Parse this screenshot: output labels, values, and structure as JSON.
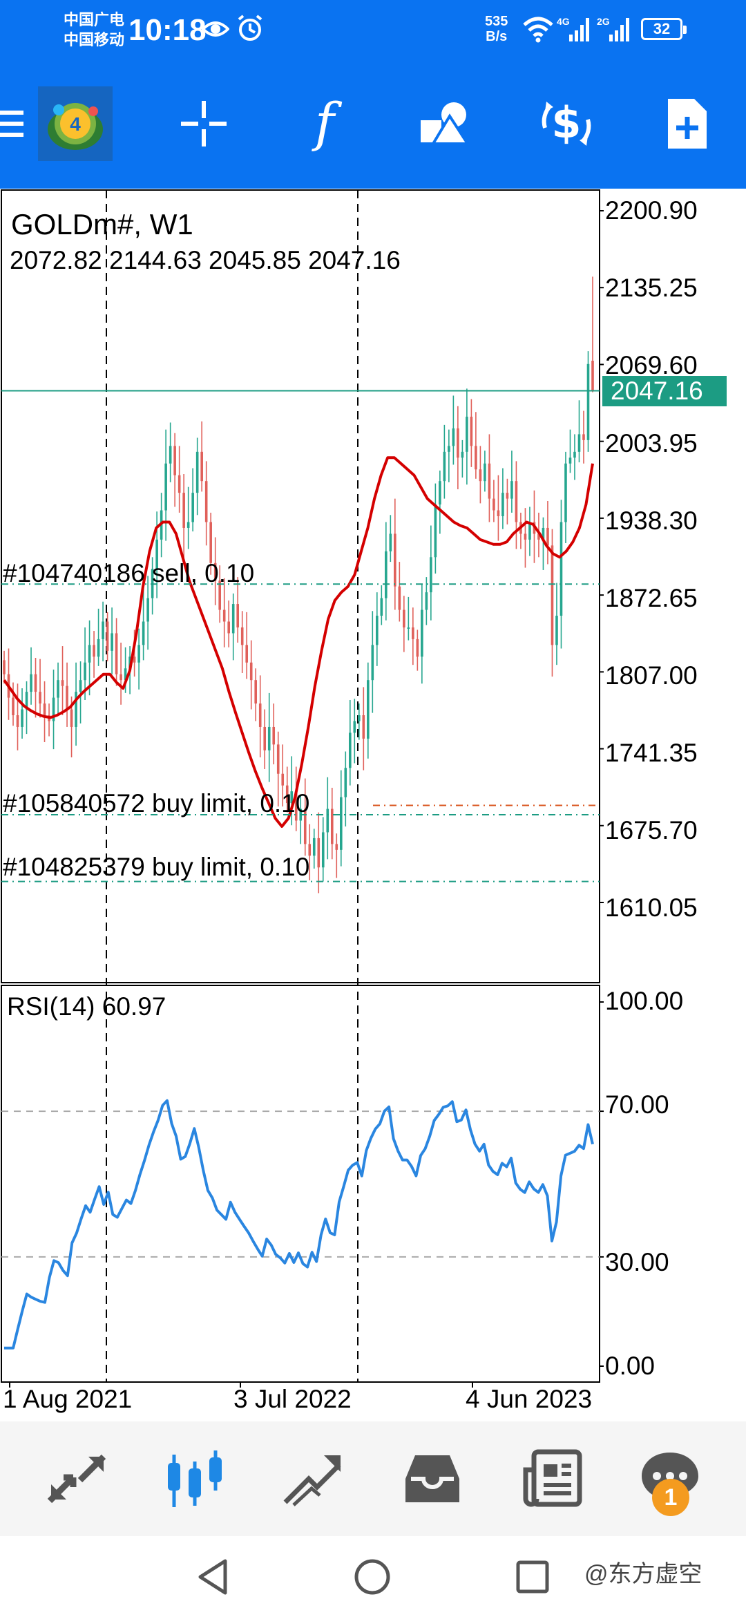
{
  "status_bar": {
    "carrier_line1": "中国广电",
    "carrier_line2": "中国移动",
    "time": "10:18",
    "net_speed_value": "535",
    "net_speed_unit": "B/s",
    "signal1_label": "4G",
    "signal2_label": "2G",
    "battery": "32",
    "icons": [
      "eye-icon",
      "alarm-off-icon",
      "wifi-icon",
      "signal-icon",
      "signal-icon",
      "battery-icon"
    ]
  },
  "toolbar": {
    "items": [
      "menu-icon",
      "app-logo",
      "crosshair-icon",
      "function-icon",
      "objects-icon",
      "trade-icon",
      "new-order-icon"
    ]
  },
  "chart": {
    "symbol_title": "GOLDm#, W1",
    "ohlc": "2072.82 2144.63 2045.85 2047.16",
    "current_price": "2047.16",
    "price_labels": [
      "2200.90",
      "2135.25",
      "2069.60",
      "2003.95",
      "1938.30",
      "1872.65",
      "1807.00",
      "1741.35",
      "1675.70",
      "1610.05"
    ],
    "orders": [
      {
        "label": "#104740186 sell, 0.10",
        "price": 1882
      },
      {
        "label": "#105840572 buy limit, 0.10",
        "price": 1685
      },
      {
        "label": "#104825379 buy limit, 0.10",
        "price": 1628
      }
    ],
    "rsi_label": "RSI(14) 60.97",
    "rsi_levels": [
      "100.00",
      "70.00",
      "30.00",
      "0.00"
    ],
    "date_labels": [
      "1 Aug 2021",
      "3 Jul 2022",
      "4 Jun 2023"
    ],
    "colors": {
      "bull": "#26a68f",
      "bear": "#e0605a",
      "ma": "#d40000",
      "rsi": "#2a86e0",
      "price_tag": "#1c9c83"
    }
  },
  "chart_data": {
    "type": "candlestick",
    "title": "GOLDm#, W1",
    "timeframe": "W1",
    "ylim": [
      1590,
      2222
    ],
    "last": {
      "open": 2072.82,
      "high": 2144.63,
      "low": 2045.85,
      "close": 2047.16
    },
    "close_series_approx": [
      1805,
      1785,
      1770,
      1760,
      1775,
      1790,
      1805,
      1790,
      1780,
      1770,
      1765,
      1785,
      1800,
      1795,
      1775,
      1760,
      1790,
      1800,
      1815,
      1830,
      1820,
      1835,
      1850,
      1825,
      1840,
      1805,
      1800,
      1810,
      1820,
      1815,
      1830,
      1850,
      1870,
      1895,
      1920,
      1945,
      1985,
      2000,
      1975,
      1960,
      1930,
      1935,
      1960,
      1995,
      1970,
      1935,
      1900,
      1885,
      1860,
      1850,
      1840,
      1865,
      1845,
      1830,
      1815,
      1800,
      1780,
      1760,
      1740,
      1760,
      1745,
      1720,
      1710,
      1695,
      1705,
      1680,
      1690,
      1660,
      1650,
      1665,
      1640,
      1670,
      1690,
      1660,
      1655,
      1700,
      1725,
      1755,
      1765,
      1770,
      1750,
      1800,
      1830,
      1855,
      1870,
      1910,
      1925,
      1880,
      1860,
      1845,
      1845,
      1835,
      1820,
      1860,
      1875,
      1905,
      1950,
      1970,
      1995,
      2000,
      2015,
      1990,
      1995,
      2025,
      2000,
      1980,
      1970,
      1985,
      1955,
      1945,
      1940,
      1960,
      1955,
      1970,
      1935,
      1925,
      1920,
      1935,
      1925,
      1920,
      1930,
      1915,
      1830,
      1855,
      1935,
      1985,
      1990,
      1995,
      2010,
      2005,
      2070,
      2047.16
    ],
    "ma_series_approx": [
      1800,
      1792,
      1784,
      1778,
      1774,
      1771,
      1769,
      1768,
      1770,
      1773,
      1777,
      1784,
      1790,
      1795,
      1800,
      1805,
      1805,
      1798,
      1793,
      1808,
      1840,
      1880,
      1910,
      1930,
      1935,
      1935,
      1925,
      1905,
      1885,
      1870,
      1855,
      1840,
      1825,
      1810,
      1790,
      1772,
      1755,
      1738,
      1722,
      1708,
      1695,
      1682,
      1675,
      1682,
      1700,
      1728,
      1760,
      1795,
      1825,
      1852,
      1868,
      1875,
      1880,
      1890,
      1910,
      1930,
      1955,
      1975,
      1990,
      1990,
      1985,
      1980,
      1975,
      1965,
      1955,
      1950,
      1945,
      1940,
      1935,
      1932,
      1930,
      1925,
      1920,
      1918,
      1916,
      1916,
      1918,
      1925,
      1930,
      1935,
      1933,
      1925,
      1915,
      1908,
      1905,
      1910,
      1918,
      1930,
      1950,
      1985
    ],
    "rsi": {
      "value": 60.97,
      "levels": [
        70,
        30
      ],
      "ylim": [
        0,
        100
      ]
    },
    "orders": [
      {
        "label": "#104740186 sell, 0.10",
        "price": 1882
      },
      {
        "label": "#105840572 buy limit, 0.10",
        "price": 1685
      },
      {
        "label": "#104825379 buy limit, 0.10",
        "price": 1628
      }
    ],
    "x_labels": [
      "1 Aug 2021",
      "3 Jul 2022",
      "4 Jun 2023"
    ]
  },
  "bottom_nav": {
    "items": [
      "quotes-icon",
      "chart-icon",
      "trade-icon",
      "history-icon",
      "news-icon",
      "chat-icon"
    ],
    "badge": "1"
  },
  "system_nav": {
    "watermark": "@东方虚空",
    "icons": [
      "back-icon",
      "home-icon",
      "recents-icon"
    ]
  }
}
